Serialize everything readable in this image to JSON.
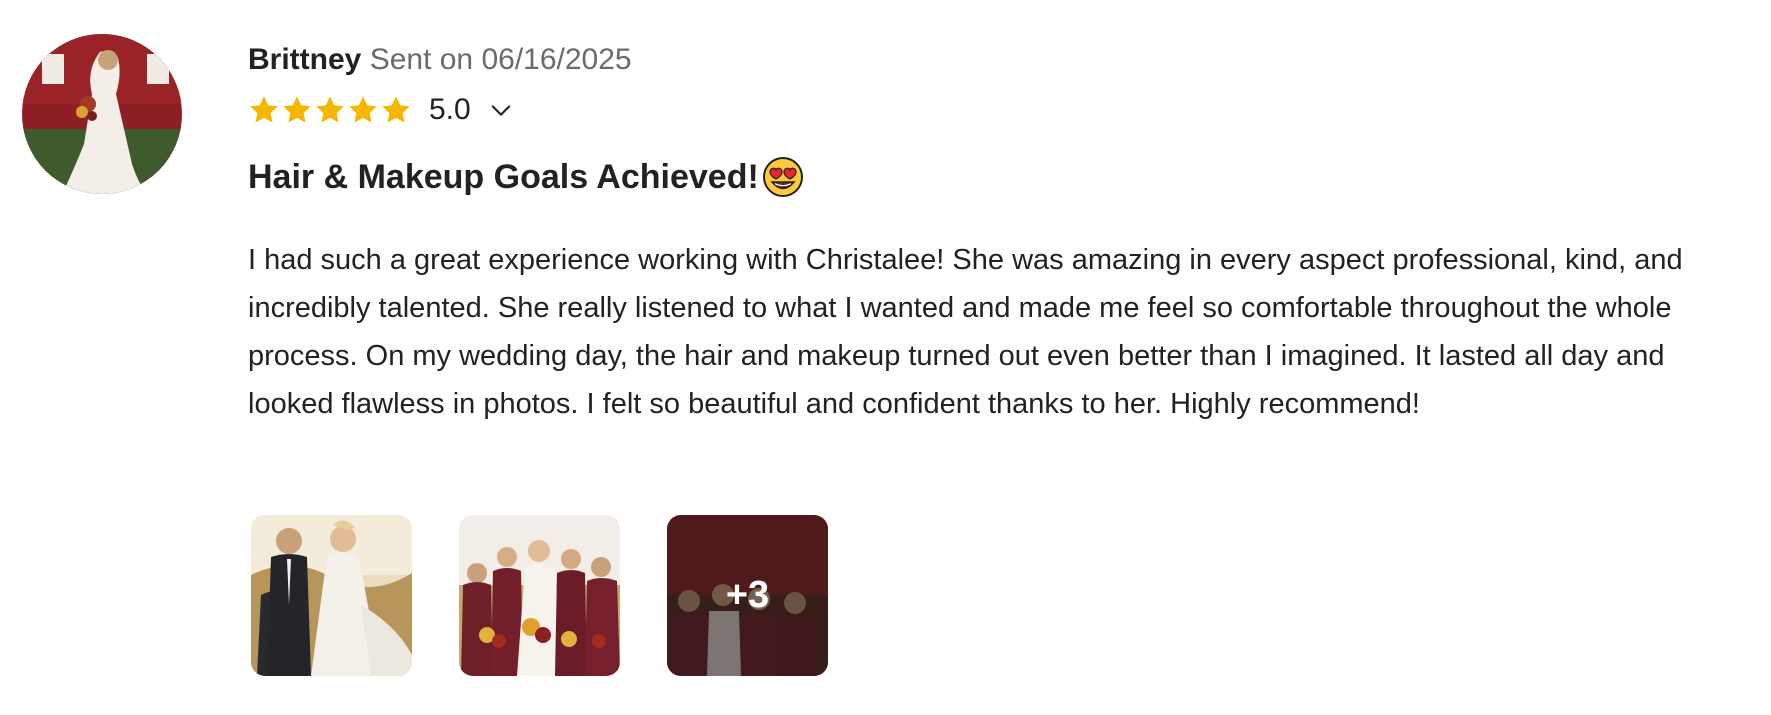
{
  "review": {
    "reviewer_name": "Brittney",
    "sent_label": "Sent on 06/16/2025",
    "rating": 5,
    "rating_text": "5.0",
    "title": "Hair & Makeup Goals Achieved!",
    "title_emoji": "heart-eyes-emoji",
    "body": "I had such a great experience working with Christalee! She was amazing in every aspect professional, kind, and incredibly talented. She really listened to what I wanted and made me feel so comfortable throughout the whole process. On my wedding day, the hair and makeup turned out even better than I imagined. It lasted all day and looked flawless in photos. I felt so beautiful and confident thanks to her. Highly recommend!",
    "photos": [
      {
        "alt": "couple-photo"
      },
      {
        "alt": "bridal-party-photo"
      },
      {
        "alt": "more-photos",
        "more_label": "+3"
      }
    ]
  },
  "colors": {
    "star": "#F5B600",
    "name": "#222222",
    "meta": "#6b6b6b",
    "body": "#222222"
  },
  "icons": {
    "star": "star-icon",
    "expand": "chevron-down-icon"
  }
}
